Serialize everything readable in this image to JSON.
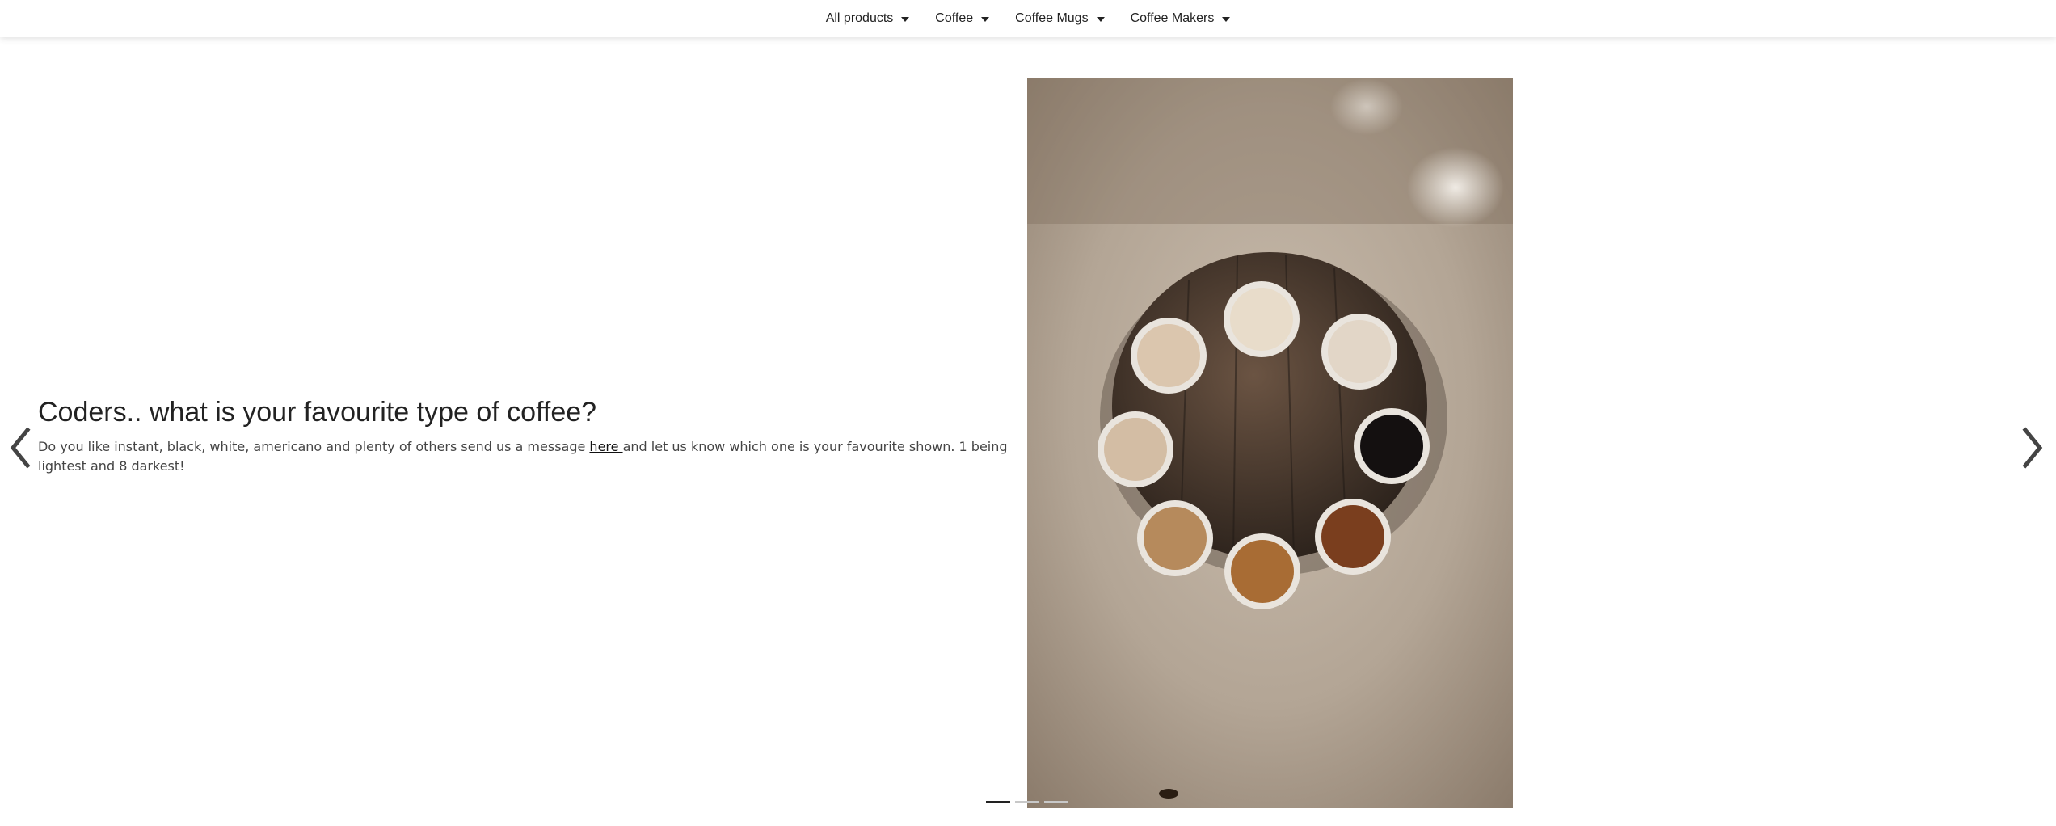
{
  "nav": {
    "items": [
      {
        "label": "All products"
      },
      {
        "label": "Coffee"
      },
      {
        "label": "Coffee Mugs"
      },
      {
        "label": "Coffee Makers"
      }
    ]
  },
  "slide": {
    "title": "Coders.. what is your favourite type of coffee?",
    "body_before_link": "Do you like instant, black, white, americano and plenty of others send us a message ",
    "link_text": "here ",
    "body_after_link": "and let us know which one is your favourite shown. 1 being lightest and 8 darkest!"
  },
  "carousel": {
    "slide_count": 3,
    "active_index": 0
  },
  "icons": {
    "prev": "chevron-left-icon",
    "next": "chevron-right-icon",
    "nav_caret": "caret-down-icon"
  },
  "colors": {
    "text": "#222222",
    "indicator_active": "#222222",
    "indicator_inactive": "#c8c8c8"
  }
}
